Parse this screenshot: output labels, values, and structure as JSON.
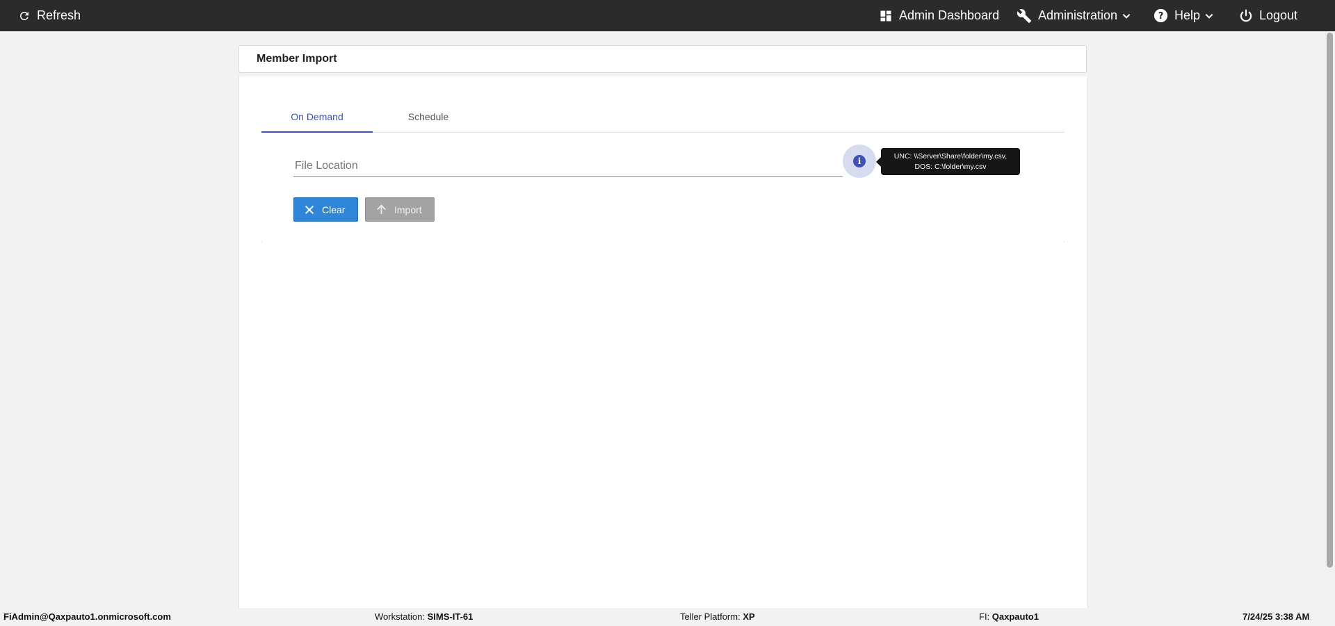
{
  "topbar": {
    "refresh_label": "Refresh",
    "admin_dashboard_label": "Admin Dashboard",
    "administration_label": "Administration",
    "help_label": "Help",
    "logout_label": "Logout",
    "icons": {
      "refresh": "refresh-icon",
      "dashboard": "dashboard-icon",
      "administration": "wrench-icon",
      "help": "help-circle-icon",
      "logout": "power-icon",
      "dropdown": "chevron-down-icon"
    }
  },
  "page": {
    "title": "Member Import"
  },
  "tabs": [
    {
      "label": "On Demand",
      "active": true
    },
    {
      "label": "Schedule",
      "active": false
    }
  ],
  "form": {
    "file_location_placeholder": "File Location",
    "file_location_value": "",
    "tooltip_line1": "UNC: \\\\Server\\Share\\folder\\my.csv,",
    "tooltip_line2": "DOS: C:\\folder\\my.csv",
    "clear_label": "Clear",
    "import_label": "Import",
    "import_enabled": false
  },
  "footer": {
    "user": "FiAdmin@Qaxpauto1.onmicrosoft.com",
    "workstation_label": "Workstation:",
    "workstation_value": "SIMS-IT-61",
    "platform_label": "Teller Platform:",
    "platform_value": "XP",
    "fi_label": "FI:",
    "fi_value": "Qaxpauto1",
    "datetime": "7/24/25 3:38 AM"
  },
  "colors": {
    "topbar_bg": "#2b2b2b",
    "accent": "#3f51b5",
    "clear_button": "#2f86d8",
    "import_disabled": "#a3a3a3",
    "page_bg": "#f2f2f2"
  }
}
